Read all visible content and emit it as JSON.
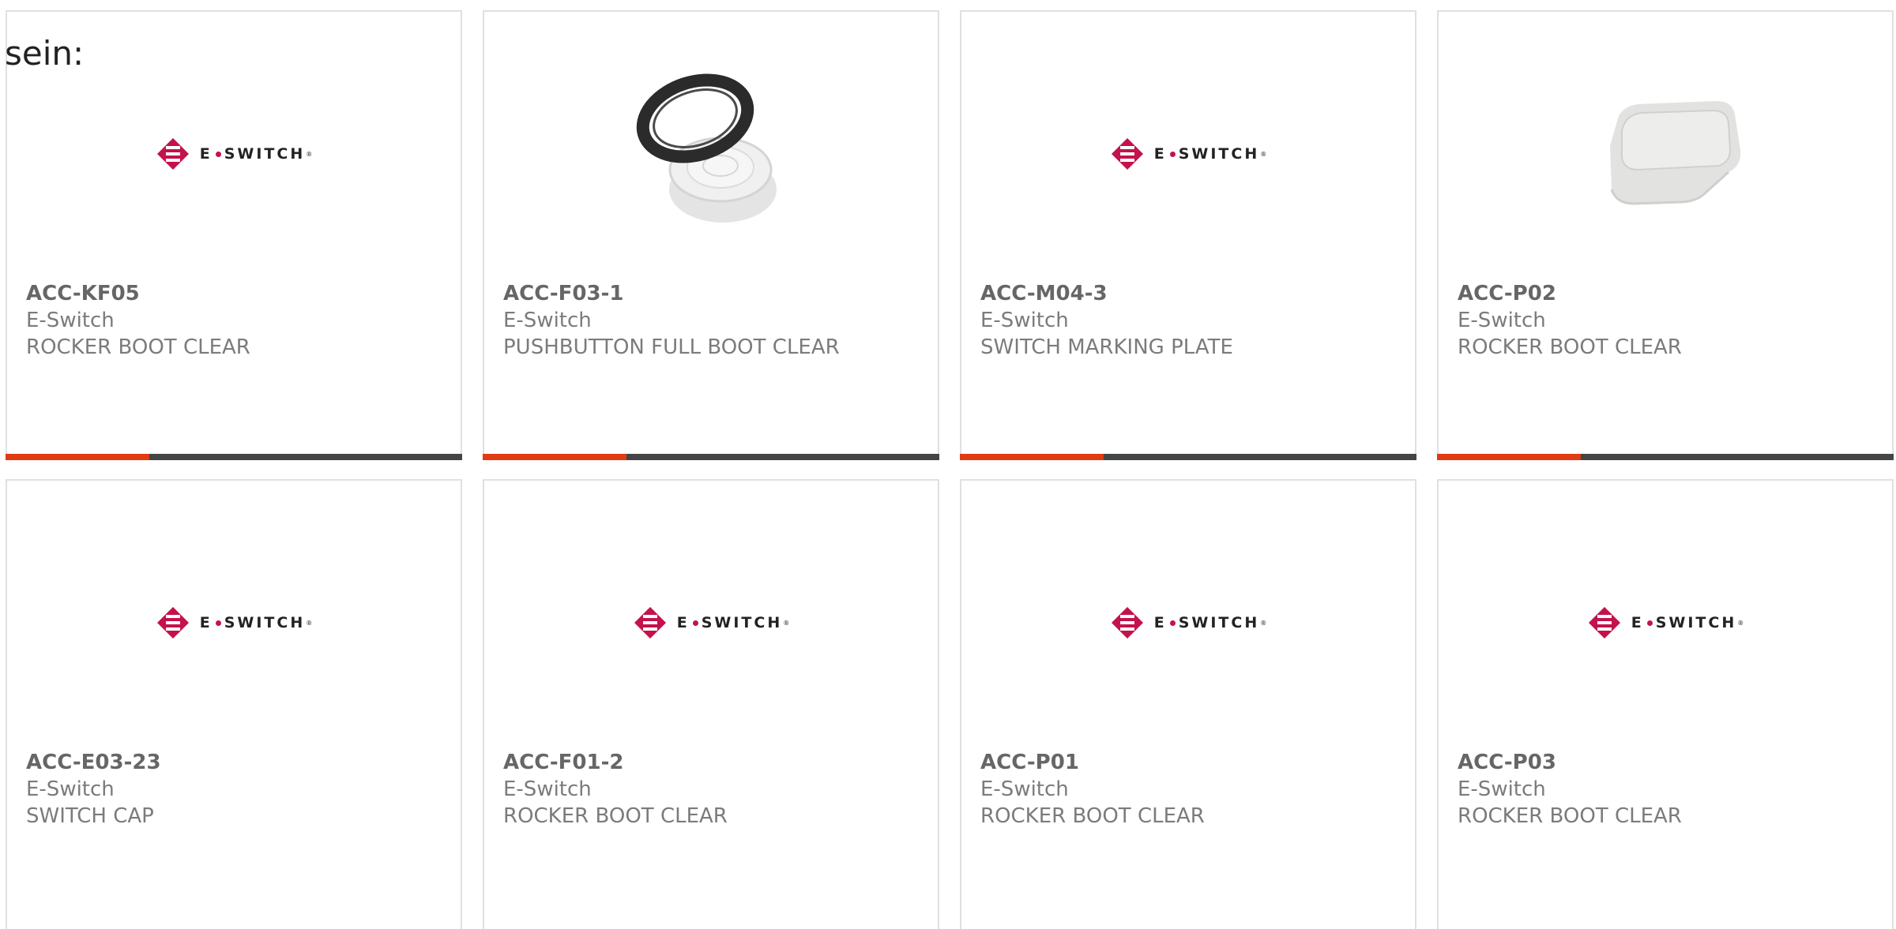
{
  "intro_text": "sein:",
  "colors": {
    "accent_bar": "#e03b12",
    "dark_bar": "#444546",
    "brand": "#c4124a"
  },
  "logo": {
    "text_left": "E",
    "text_right": "SWITCH",
    "mark": "®"
  },
  "products": [
    {
      "part_number": "ACC-KF05",
      "manufacturer": "E-Switch",
      "description": "ROCKER BOOT CLEAR",
      "image": "e-switch-logo"
    },
    {
      "part_number": "ACC-F03-1",
      "manufacturer": "E-Switch",
      "description": "PUSHBUTTON FULL BOOT CLEAR",
      "image": "pushbutton-boot-photo"
    },
    {
      "part_number": "ACC-M04-3",
      "manufacturer": "E-Switch",
      "description": "SWITCH MARKING PLATE",
      "image": "e-switch-logo"
    },
    {
      "part_number": "ACC-P02",
      "manufacturer": "E-Switch",
      "description": "ROCKER BOOT CLEAR",
      "image": "rocker-boot-photo"
    },
    {
      "part_number": "ACC-E03-23",
      "manufacturer": "E-Switch",
      "description": "SWITCH CAP",
      "image": "e-switch-logo"
    },
    {
      "part_number": "ACC-F01-2",
      "manufacturer": "E-Switch",
      "description": "ROCKER BOOT CLEAR",
      "image": "e-switch-logo"
    },
    {
      "part_number": "ACC-P01",
      "manufacturer": "E-Switch",
      "description": "ROCKER BOOT CLEAR",
      "image": "e-switch-logo"
    },
    {
      "part_number": "ACC-P03",
      "manufacturer": "E-Switch",
      "description": "ROCKER BOOT CLEAR",
      "image": "e-switch-logo"
    }
  ]
}
